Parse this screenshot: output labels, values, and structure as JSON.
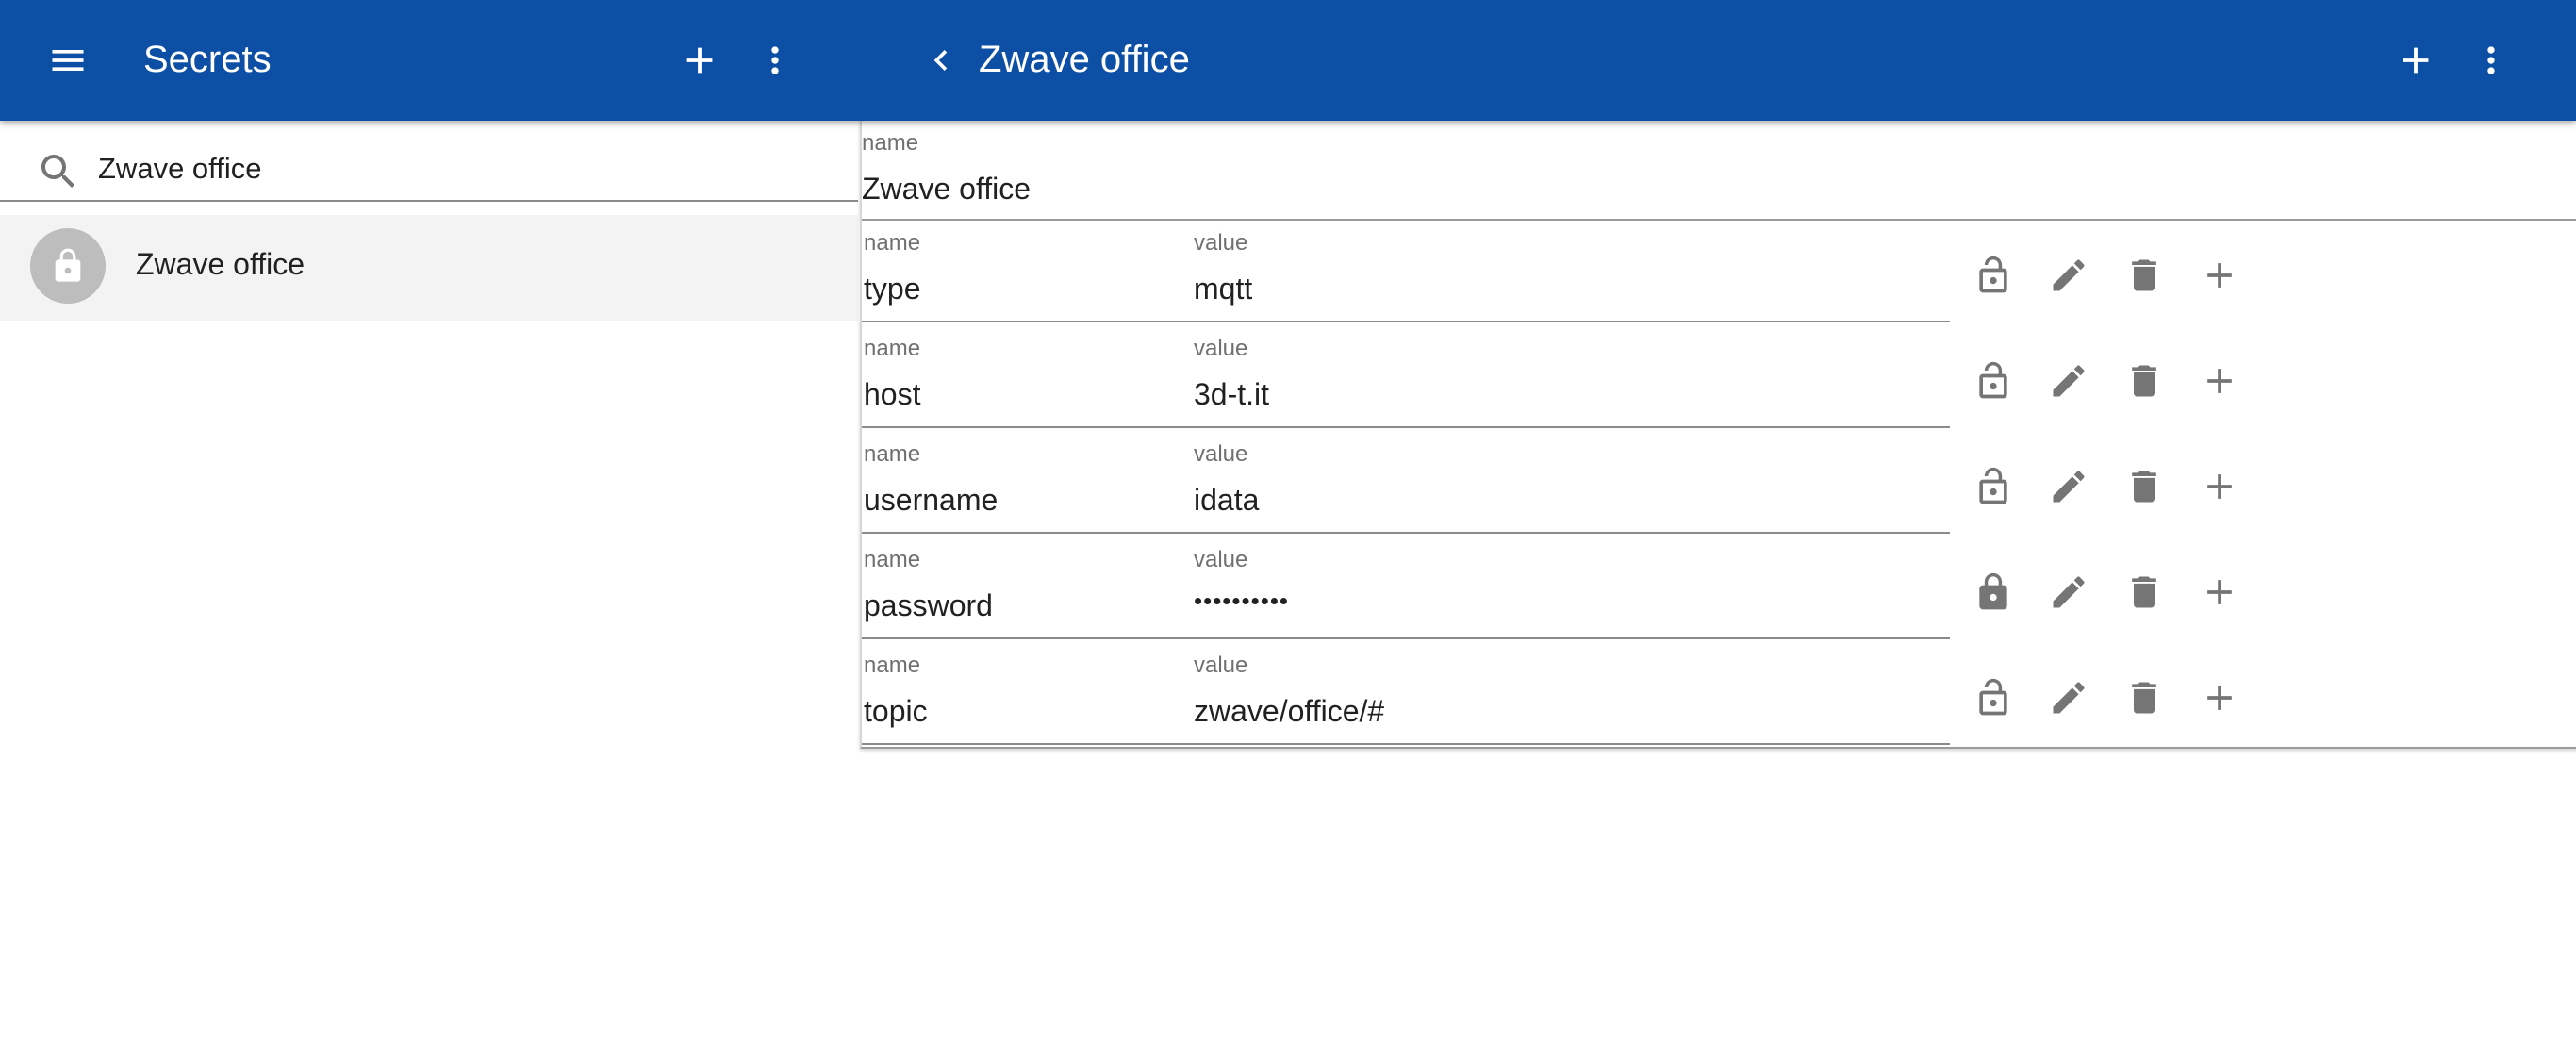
{
  "header": {
    "menu_icon": "menu-icon",
    "title": "Secrets",
    "add_icon": "plus-icon",
    "more_icon": "more-vert-icon",
    "back_icon": "chevron-left-icon",
    "detail_title": "Zwave office",
    "background_color": "#0d4fa4"
  },
  "search": {
    "icon": "search-icon",
    "value": "Zwave office"
  },
  "list": {
    "items": [
      {
        "label": "Zwave office",
        "icon": "lock-icon"
      }
    ]
  },
  "detail": {
    "name_label": "name",
    "name_value": "Zwave office",
    "fields": [
      {
        "name_label": "name",
        "name": "type",
        "value_label": "value",
        "value": "mqtt",
        "locked": false
      },
      {
        "name_label": "name",
        "name": "host",
        "value_label": "value",
        "value": "3d-t.it",
        "locked": false
      },
      {
        "name_label": "name",
        "name": "username",
        "value_label": "value",
        "value": "idata",
        "locked": false
      },
      {
        "name_label": "name",
        "name": "password",
        "value_label": "value",
        "value": "••••••••••",
        "locked": true
      },
      {
        "name_label": "name",
        "name": "topic",
        "value_label": "value",
        "value": "zwave/office/#",
        "locked": false
      }
    ]
  }
}
